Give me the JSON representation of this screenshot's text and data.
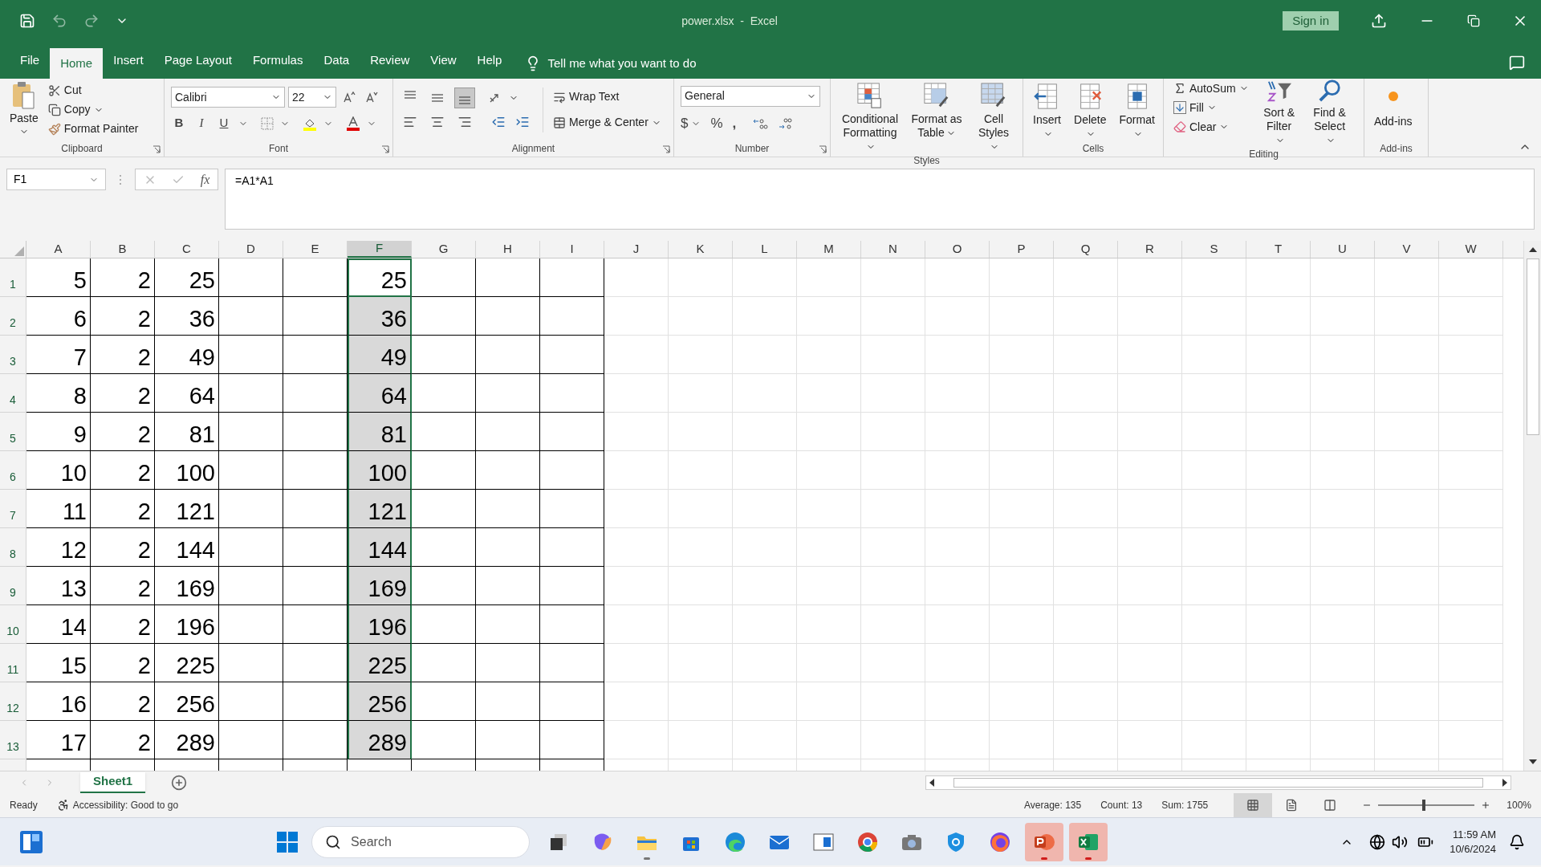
{
  "title_bar": {
    "title": "power.xlsx  -  Excel",
    "sign_in": "Sign in"
  },
  "menu_tabs": [
    {
      "label": "File",
      "selected": false
    },
    {
      "label": "Home",
      "selected": true
    },
    {
      "label": "Insert",
      "selected": false
    },
    {
      "label": "Page Layout",
      "selected": false
    },
    {
      "label": "Formulas",
      "selected": false
    },
    {
      "label": "Data",
      "selected": false
    },
    {
      "label": "Review",
      "selected": false
    },
    {
      "label": "View",
      "selected": false
    },
    {
      "label": "Help",
      "selected": false
    }
  ],
  "tell_me": "Tell me what you want to do",
  "ribbon": {
    "clipboard": {
      "paste": "Paste",
      "cut": "Cut",
      "copy": "Copy",
      "format_painter": "Format Painter",
      "label": "Clipboard"
    },
    "font": {
      "name": "Calibri",
      "size": "22",
      "bold": "B",
      "italic": "I",
      "underline": "U",
      "label": "Font"
    },
    "alignment": {
      "vertical": [
        {
          "selected": false
        },
        {
          "selected": false
        },
        {
          "selected": true
        }
      ],
      "wrap_text": "Wrap Text",
      "merge": "Merge & Center",
      "label": "Alignment"
    },
    "number": {
      "format": "General",
      "currency": "$",
      "percent": "%",
      "comma": ",",
      "label": "Number"
    },
    "styles": {
      "buttons": [
        "Conditional Formatting",
        "Format as Table",
        "Cell Styles"
      ],
      "label": "Styles"
    },
    "cells": {
      "buttons": [
        "Insert",
        "Delete",
        "Format"
      ],
      "label": "Cells"
    },
    "editing": {
      "autosum": "AutoSum",
      "fill": "Fill",
      "clear": "Clear",
      "sort": "Sort & Filter",
      "find": "Find & Select",
      "label": "Editing"
    },
    "addins": {
      "button": "Add-ins",
      "label": "Add-ins"
    }
  },
  "formula_bar": {
    "name_box": "F1",
    "fx": "fx",
    "formula": "=A1*A1"
  },
  "sheet": {
    "columns": [
      {
        "label": "A",
        "selected": false
      },
      {
        "label": "B",
        "selected": false
      },
      {
        "label": "C",
        "selected": false
      },
      {
        "label": "D",
        "selected": false
      },
      {
        "label": "E",
        "selected": false
      },
      {
        "label": "F",
        "selected": true
      },
      {
        "label": "G",
        "selected": false
      },
      {
        "label": "H",
        "selected": false
      },
      {
        "label": "I",
        "selected": false
      },
      {
        "label": "J",
        "selected": false
      },
      {
        "label": "K",
        "selected": false
      },
      {
        "label": "L",
        "selected": false
      },
      {
        "label": "M",
        "selected": false
      },
      {
        "label": "N",
        "selected": false
      },
      {
        "label": "O",
        "selected": false
      },
      {
        "label": "P",
        "selected": false
      },
      {
        "label": "Q",
        "selected": false
      },
      {
        "label": "R",
        "selected": false
      },
      {
        "label": "S",
        "selected": false
      },
      {
        "label": "T",
        "selected": false
      },
      {
        "label": "U",
        "selected": false
      },
      {
        "label": "V",
        "selected": false
      },
      {
        "label": "W",
        "selected": false
      }
    ],
    "rows": [
      {
        "number": "1",
        "selected": true,
        "cells": [
          {
            "value": "5",
            "selected": false
          },
          {
            "value": "2",
            "selected": false
          },
          {
            "value": "25",
            "selected": false
          },
          {
            "selected": false
          },
          {
            "selected": false
          },
          {
            "value": "25",
            "selected": true
          },
          {
            "selected": false
          },
          {
            "selected": false
          },
          {
            "selected": false
          }
        ]
      },
      {
        "number": "2",
        "selected": true,
        "cells": [
          {
            "value": "6",
            "selected": false
          },
          {
            "value": "2",
            "selected": false
          },
          {
            "value": "36",
            "selected": false
          },
          {
            "selected": false
          },
          {
            "selected": false
          },
          {
            "value": "36",
            "selected": true
          },
          {
            "selected": false
          },
          {
            "selected": false
          },
          {
            "selected": false
          }
        ]
      },
      {
        "number": "3",
        "selected": true,
        "cells": [
          {
            "value": "7",
            "selected": false
          },
          {
            "value": "2",
            "selected": false
          },
          {
            "value": "49",
            "selected": false
          },
          {
            "selected": false
          },
          {
            "selected": false
          },
          {
            "value": "49",
            "selected": true
          },
          {
            "selected": false
          },
          {
            "selected": false
          },
          {
            "selected": false
          }
        ]
      },
      {
        "number": "4",
        "selected": true,
        "cells": [
          {
            "value": "8",
            "selected": false
          },
          {
            "value": "2",
            "selected": false
          },
          {
            "value": "64",
            "selected": false
          },
          {
            "selected": false
          },
          {
            "selected": false
          },
          {
            "value": "64",
            "selected": true
          },
          {
            "selected": false
          },
          {
            "selected": false
          },
          {
            "selected": false
          }
        ]
      },
      {
        "number": "5",
        "selected": true,
        "cells": [
          {
            "value": "9",
            "selected": false
          },
          {
            "value": "2",
            "selected": false
          },
          {
            "value": "81",
            "selected": false
          },
          {
            "selected": false
          },
          {
            "selected": false
          },
          {
            "value": "81",
            "selected": true
          },
          {
            "selected": false
          },
          {
            "selected": false
          },
          {
            "selected": false
          }
        ]
      },
      {
        "number": "6",
        "selected": true,
        "cells": [
          {
            "value": "10",
            "selected": false
          },
          {
            "value": "2",
            "selected": false
          },
          {
            "value": "100",
            "selected": false
          },
          {
            "selected": false
          },
          {
            "selected": false
          },
          {
            "value": "100",
            "selected": true
          },
          {
            "selected": false
          },
          {
            "selected": false
          },
          {
            "selected": false
          }
        ]
      },
      {
        "number": "7",
        "selected": true,
        "cells": [
          {
            "value": "11",
            "selected": false
          },
          {
            "value": "2",
            "selected": false
          },
          {
            "value": "121",
            "selected": false
          },
          {
            "selected": false
          },
          {
            "selected": false
          },
          {
            "value": "121",
            "selected": true
          },
          {
            "selected": false
          },
          {
            "selected": false
          },
          {
            "selected": false
          }
        ]
      },
      {
        "number": "8",
        "selected": true,
        "cells": [
          {
            "value": "12",
            "selected": false
          },
          {
            "value": "2",
            "selected": false
          },
          {
            "value": "144",
            "selected": false
          },
          {
            "selected": false
          },
          {
            "selected": false
          },
          {
            "value": "144",
            "selected": true
          },
          {
            "selected": false
          },
          {
            "selected": false
          },
          {
            "selected": false
          }
        ]
      },
      {
        "number": "9",
        "selected": true,
        "cells": [
          {
            "value": "13",
            "selected": false
          },
          {
            "value": "2",
            "selected": false
          },
          {
            "value": "169",
            "selected": false
          },
          {
            "selected": false
          },
          {
            "selected": false
          },
          {
            "value": "169",
            "selected": true
          },
          {
            "selected": false
          },
          {
            "selected": false
          },
          {
            "selected": false
          }
        ]
      },
      {
        "number": "10",
        "selected": true,
        "cells": [
          {
            "value": "14",
            "selected": false
          },
          {
            "value": "2",
            "selected": false
          },
          {
            "value": "196",
            "selected": false
          },
          {
            "selected": false
          },
          {
            "selected": false
          },
          {
            "value": "196",
            "selected": true
          },
          {
            "selected": false
          },
          {
            "selected": false
          },
          {
            "selected": false
          }
        ]
      },
      {
        "number": "11",
        "selected": true,
        "cells": [
          {
            "value": "15",
            "selected": false
          },
          {
            "value": "2",
            "selected": false
          },
          {
            "value": "225",
            "selected": false
          },
          {
            "selected": false
          },
          {
            "selected": false
          },
          {
            "value": "225",
            "selected": true
          },
          {
            "selected": false
          },
          {
            "selected": false
          },
          {
            "selected": false
          }
        ]
      },
      {
        "number": "12",
        "selected": true,
        "cells": [
          {
            "value": "16",
            "selected": false
          },
          {
            "value": "2",
            "selected": false
          },
          {
            "value": "256",
            "selected": false
          },
          {
            "selected": false
          },
          {
            "selected": false
          },
          {
            "value": "256",
            "selected": true
          },
          {
            "selected": false
          },
          {
            "selected": false
          },
          {
            "selected": false
          }
        ]
      },
      {
        "number": "13",
        "selected": true,
        "cells": [
          {
            "value": "17",
            "selected": false
          },
          {
            "value": "2",
            "selected": false
          },
          {
            "value": "289",
            "selected": false
          },
          {
            "selected": false
          },
          {
            "selected": false
          },
          {
            "value": "289",
            "selected": true
          },
          {
            "selected": false
          },
          {
            "selected": false
          },
          {
            "selected": false
          }
        ]
      }
    ],
    "sheet_tabs": [
      {
        "label": "Sheet1",
        "selected": true
      }
    ]
  },
  "status_bar": {
    "ready": "Ready",
    "accessibility": "Accessibility: Good to go",
    "average": "Average: 135",
    "count": "Count: 13",
    "sum": "Sum: 1755",
    "views": [
      {
        "selected": true
      },
      {
        "selected": false
      },
      {
        "selected": false
      }
    ],
    "zoom": {
      "level": 0.47,
      "label": "100%"
    }
  },
  "taskbar": {
    "search": {
      "placeholder": "Search"
    },
    "apps": [
      {
        "running": false,
        "selected": false
      },
      {
        "running": false,
        "selected": false
      },
      {
        "running": true,
        "selected": false
      },
      {
        "running": false,
        "selected": false
      },
      {
        "running": false,
        "selected": false
      },
      {
        "running": false,
        "selected": false
      },
      {
        "running": false,
        "selected": false
      },
      {
        "running": false,
        "selected": false
      },
      {
        "running": false,
        "selected": false
      },
      {
        "running": false,
        "selected": false
      },
      {
        "running": false,
        "selected": false
      },
      {
        "running": true,
        "selected": true
      },
      {
        "running": true,
        "selected": true
      }
    ],
    "time": "11:59 AM",
    "date": "10/6/2024"
  }
}
